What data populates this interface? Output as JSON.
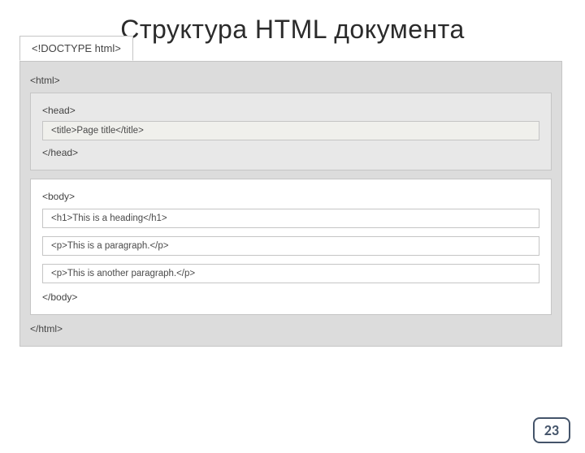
{
  "title": "Структура HTML документа",
  "doctype": "<!DOCTYPE html>",
  "html_open": "<html>",
  "html_close": "</html>",
  "head_open": "<head>",
  "head_close": "</head>",
  "title_line": "<title>Page title</title>",
  "body_open": "<body>",
  "body_close": "</body>",
  "h1_line": "<h1>This is a heading</h1>",
  "p1_line": "<p>This is a paragraph.</p>",
  "p2_line": "<p>This is another paragraph.</p>",
  "page_number": "23"
}
